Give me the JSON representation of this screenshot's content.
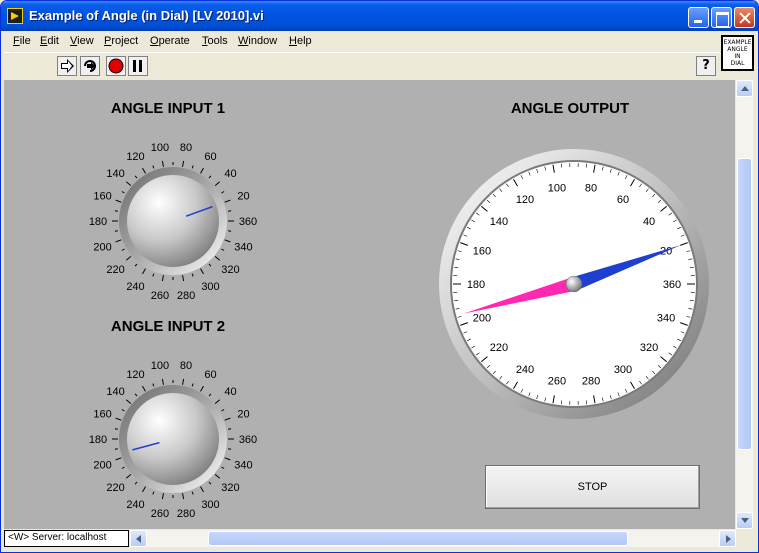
{
  "window": {
    "title": "Example of Angle (in Dial) [LV 2010].vi"
  },
  "menu": {
    "items": [
      "File",
      "Edit",
      "View",
      "Project",
      "Operate",
      "Tools",
      "Window",
      "Help"
    ]
  },
  "toolbar": {
    "buttons": [
      "run-arrow-icon",
      "run-continuously-icon",
      "abort-icon",
      "pause-icon"
    ],
    "help": "?"
  },
  "vi_icon": {
    "lines": [
      "EXAMPLE",
      "ANGLE",
      "IN",
      "DIAL"
    ]
  },
  "controls": {
    "input1": {
      "label": "ANGLE INPUT 1",
      "value_deg": 20
    },
    "input2": {
      "label": "ANGLE INPUT 2",
      "value_deg": 195
    },
    "output": {
      "label": "ANGLE OUTPUT",
      "needle1_deg": 20,
      "needle2_deg": 195
    },
    "knob_ticks": [
      "20",
      "40",
      "60",
      "80",
      "100",
      "120",
      "140",
      "160",
      "180",
      "200",
      "220",
      "240",
      "260",
      "280",
      "300",
      "320",
      "340",
      "360"
    ],
    "stop_label": "STOP"
  },
  "status": {
    "text": "<W> Server: localhost"
  },
  "colors": {
    "panel": "#b0b0b0",
    "needle_blue": "#1f3fd0",
    "needle_pink": "#ff28b0",
    "titlebar": "#0054e3"
  }
}
